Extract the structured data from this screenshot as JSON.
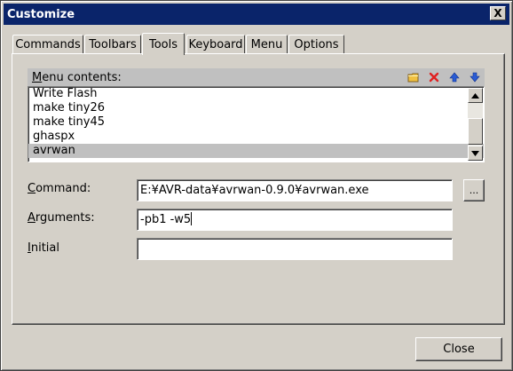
{
  "window": {
    "title": "Customize",
    "close_glyph": "X"
  },
  "tabs": [
    {
      "label": "Commands",
      "active": false
    },
    {
      "label": "Toolbars",
      "active": false
    },
    {
      "label": "Tools",
      "active": true
    },
    {
      "label": "Keyboard",
      "active": false
    },
    {
      "label": "Menu",
      "active": false
    },
    {
      "label": "Options",
      "active": false
    }
  ],
  "menu_contents": {
    "label_underlined": "M",
    "label_rest": "enu contents:",
    "icons": [
      "new-folder-icon",
      "delete-icon",
      "move-up-icon",
      "move-down-icon"
    ],
    "items": [
      "Write Flash",
      "make tiny26",
      "make tiny45",
      "ghaspx",
      "avrwan"
    ],
    "selected_index": 4
  },
  "fields": {
    "command": {
      "label_underlined": "C",
      "label_rest": "ommand:",
      "value": "E:¥AVR-data¥avrwan-0.9.0¥avrwan.exe"
    },
    "arguments": {
      "label_underlined": "A",
      "label_rest": "rguments:",
      "value": "-pb1 -w5"
    },
    "initial": {
      "label_underlined": "I",
      "label_rest": "nitial",
      "value": ""
    }
  },
  "browse_button": {
    "label": "..."
  },
  "close_button": {
    "label": "Close"
  },
  "colors": {
    "title_bar": "#0a246a",
    "face": "#d4d0c8",
    "selection": "#c0c0c0",
    "delete_icon": "#e02020",
    "arrow_icon": "#2a5cd4",
    "folder_icon": "#f0c040"
  }
}
